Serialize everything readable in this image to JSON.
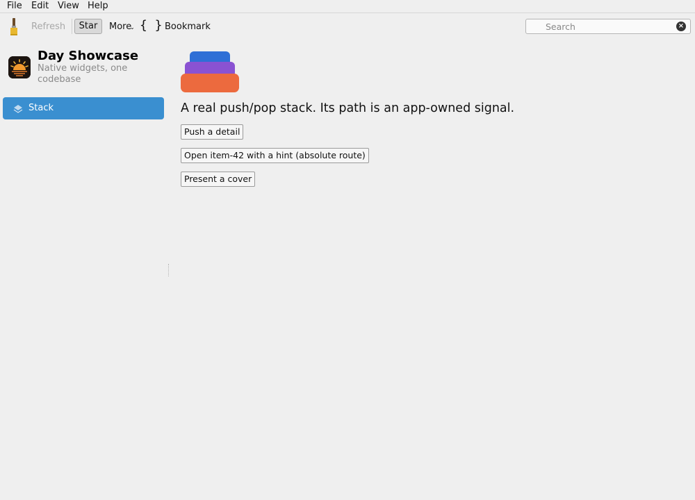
{
  "menubar": {
    "items": [
      "File",
      "Edit",
      "View",
      "Help"
    ]
  },
  "toolbar": {
    "brush_icon": "paintbrush-icon",
    "refresh_label": "Refresh",
    "star_label": "Star",
    "more_label": "More",
    "more_caret": "⌄",
    "braces_label": "{ }",
    "bookmark_label": "Bookmark",
    "search_placeholder": "Search",
    "clear_icon": "×"
  },
  "sidebar": {
    "app_title": "Day Showcase",
    "app_subtitle": "Native widgets, one codebase",
    "app_icon": "sunrise-icon",
    "items": [
      {
        "label": "Stack",
        "icon": "layers-icon",
        "selected": true
      }
    ]
  },
  "main": {
    "description": "A real push/pop stack. Its path is an app-owned signal.",
    "buttons": [
      "Push a detail",
      "Open item-42 with a hint (absolute route)",
      "Present a cover"
    ]
  },
  "colors": {
    "selection": "#3a8fd0",
    "stack_top": "#2f6fd6",
    "stack_middle": "#8a52d2",
    "stack_bottom": "#ec6a3e"
  }
}
